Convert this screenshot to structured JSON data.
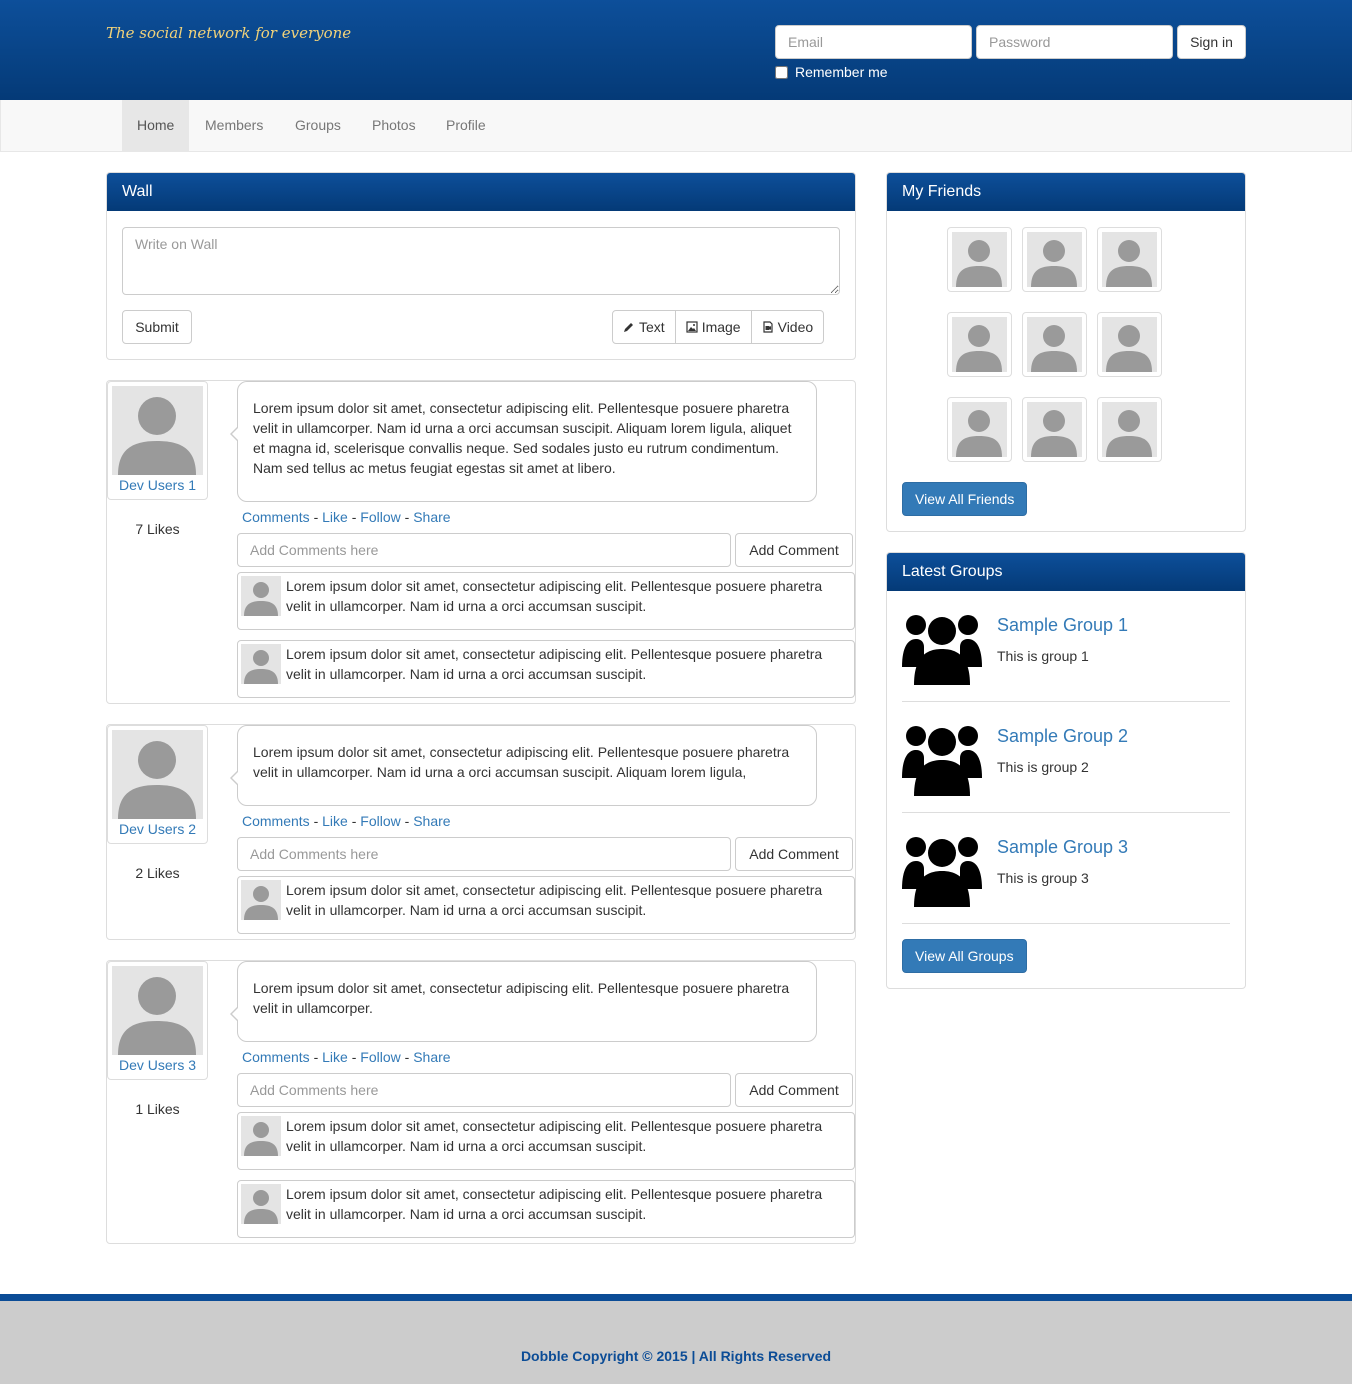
{
  "header": {
    "tagline": "The social network for everyone",
    "email_placeholder": "Email",
    "password_placeholder": "Password",
    "signin_label": "Sign in",
    "remember_label": "Remember me"
  },
  "nav": {
    "items": [
      {
        "label": "Home",
        "active": true
      },
      {
        "label": "Members"
      },
      {
        "label": "Groups"
      },
      {
        "label": "Photos"
      },
      {
        "label": "Profile"
      }
    ]
  },
  "wall": {
    "title": "Wall",
    "placeholder": "Write on Wall",
    "submit_label": "Submit",
    "text_label": "Text",
    "image_label": "Image",
    "video_label": "Video"
  },
  "posts": [
    {
      "user": "Dev Users 1",
      "text": "Lorem ipsum dolor sit amet, consectetur adipiscing elit. Pellentesque posuere pharetra velit in ullamcorper. Nam id urna a orci accumsan suscipit. Aliquam lorem ligula, aliquet et magna id, scelerisque convallis neque. Sed sodales justo eu rutrum condimentum. Nam sed tellus ac metus feugiat egestas sit amet at libero.",
      "likes": "7 Likes",
      "comments": [
        "Lorem ipsum dolor sit amet, consectetur adipiscing elit. Pellentesque posuere pharetra velit in ullamcorper. Nam id urna a orci accumsan suscipit.",
        "Lorem ipsum dolor sit amet, consectetur adipiscing elit. Pellentesque posuere pharetra velit in ullamcorper. Nam id urna a orci accumsan suscipit."
      ]
    },
    {
      "user": "Dev Users 2",
      "text": "Lorem ipsum dolor sit amet, consectetur adipiscing elit. Pellentesque posuere pharetra velit in ullamcorper. Nam id urna a orci accumsan suscipit. Aliquam lorem ligula,",
      "likes": "2 Likes",
      "comments": [
        "Lorem ipsum dolor sit amet, consectetur adipiscing elit. Pellentesque posuere pharetra velit in ullamcorper. Nam id urna a orci accumsan suscipit."
      ]
    },
    {
      "user": "Dev Users 3",
      "text": "Lorem ipsum dolor sit amet, consectetur adipiscing elit. Pellentesque posuere pharetra velit in ullamcorper.",
      "likes": "1 Likes",
      "comments": [
        "Lorem ipsum dolor sit amet, consectetur adipiscing elit. Pellentesque posuere pharetra velit in ullamcorper. Nam id urna a orci accumsan suscipit.",
        "Lorem ipsum dolor sit amet, consectetur adipiscing elit. Pellentesque posuere pharetra velit in ullamcorper. Nam id urna a orci accumsan suscipit."
      ]
    }
  ],
  "post_actions": {
    "comments": "Comments",
    "like": "Like",
    "follow": "Follow",
    "share": "Share",
    "comment_placeholder": "Add Comments here",
    "add_comment_label": "Add Comment"
  },
  "friends": {
    "title": "My Friends",
    "view_all_label": "View All Friends"
  },
  "groups": {
    "title": "Latest Groups",
    "items": [
      {
        "name": "Sample Group 1",
        "desc": "This is group 1"
      },
      {
        "name": "Sample Group 2",
        "desc": "This is group 2"
      },
      {
        "name": "Sample Group 3",
        "desc": "This is group 3"
      }
    ],
    "view_all_label": "View All Groups"
  },
  "footer": {
    "text": "Dobble Copyright © 2015 | All Rights Reserved"
  },
  "colors": {
    "brand_blue": "#0b4c96",
    "link_blue": "#337ab7",
    "tagline_yellow": "#f1d27a"
  }
}
